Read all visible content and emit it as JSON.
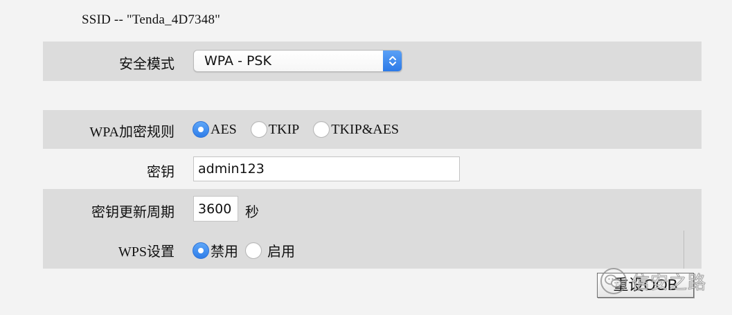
{
  "ssid_line": "SSID -- \"Tenda_4D7348\"",
  "security_mode": {
    "label": "安全模式",
    "selected": "WPA - PSK",
    "arrow_icon": "updown-chevron-icon",
    "accent": "#2f7ee9"
  },
  "encryption": {
    "label": "WPA加密规则",
    "options": [
      "AES",
      "TKIP",
      "TKIP&AES"
    ],
    "selected": "AES"
  },
  "key": {
    "label": "密钥",
    "value": "admin123"
  },
  "key_renewal": {
    "label": "密钥更新周期",
    "value": "3600",
    "unit": "秒"
  },
  "wps": {
    "label": "WPS设置",
    "options": [
      "禁用",
      "启用"
    ],
    "selected": "禁用"
  },
  "reset_button": {
    "label": "重设OOB"
  },
  "watermark": {
    "text": "信安之路",
    "icon": "wechat-icon"
  },
  "colors": {
    "band": "#dcdcdc",
    "background": "#f3f3f3",
    "radio_selected": "#2f7ee9"
  }
}
